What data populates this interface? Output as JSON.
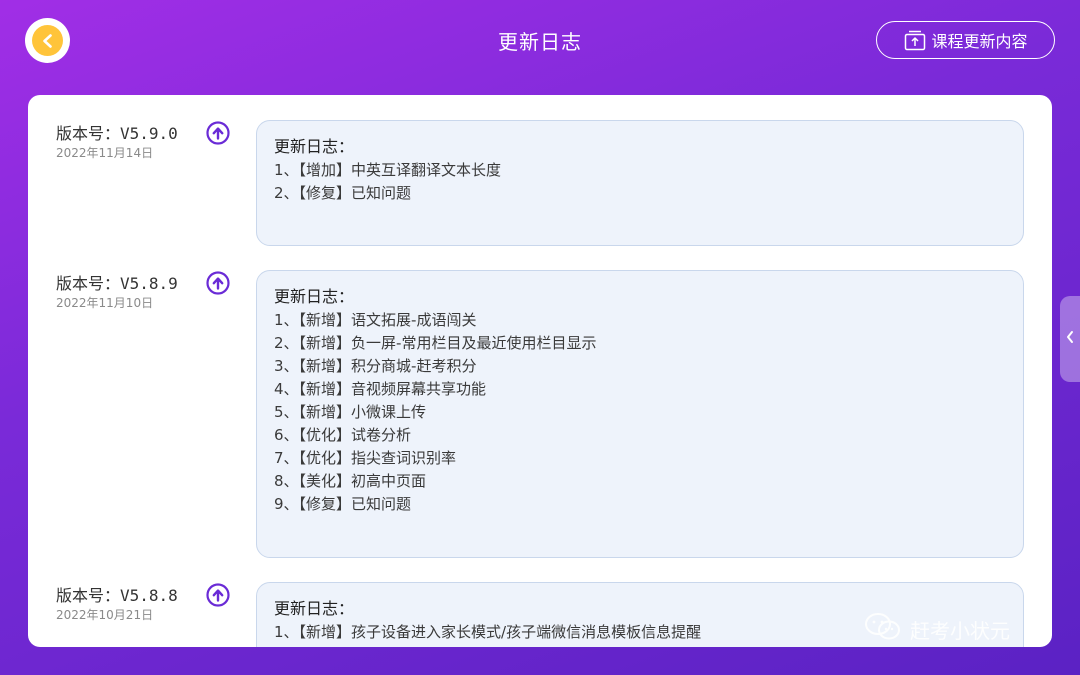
{
  "header": {
    "title": "更新日志",
    "course_button_label": "课程更新内容"
  },
  "versions": [
    {
      "label": "版本号：V5.9.0",
      "date": "2022年11月14日",
      "log_title": "更新日志：",
      "items": [
        "1、【增加】中英互译翻译文本长度",
        "2、【修复】已知问题"
      ]
    },
    {
      "label": "版本号：V5.8.9",
      "date": "2022年11月10日",
      "log_title": "更新日志：",
      "items": [
        "1、【新增】语文拓展-成语闯关",
        "2、【新增】负一屏-常用栏目及最近使用栏目显示",
        "3、【新增】积分商城-赶考积分",
        "4、【新增】音视频屏幕共享功能",
        "5、【新增】小微课上传",
        "6、【优化】试卷分析",
        "7、【优化】指尖查词识别率",
        "8、【美化】初高中页面",
        "9、【修复】已知问题"
      ]
    },
    {
      "label": "版本号：V5.8.8",
      "date": "2022年10月21日",
      "log_title": "更新日志：",
      "items": [
        "1、【新增】孩子设备进入家长模式/孩子端微信消息模板信息提醒"
      ]
    }
  ],
  "watermark": "赶考小状元",
  "colors": {
    "background_start": "#a12ee6",
    "background_end": "#5b22c4",
    "accent_purple": "#6a2bd6",
    "back_button_yellow": "#ffc43a",
    "log_box_bg": "#eef3fb"
  }
}
